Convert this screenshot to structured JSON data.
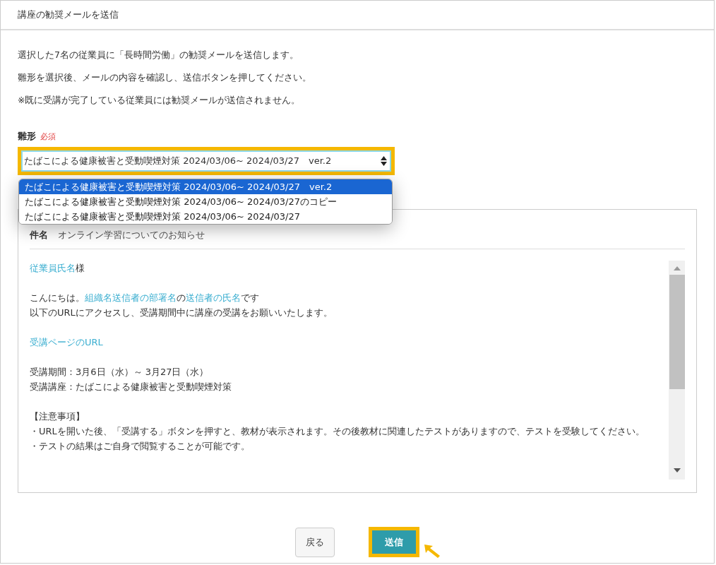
{
  "dialog": {
    "title": "講座の勧奨メールを送信"
  },
  "intro": [
    "選択した7名の従業員に「長時間労働」の勧奨メールを送信します。",
    "雛形を選択後、メールの内容を確認し、送信ボタンを押してください。",
    "※既に受講が完了している従業員には勧奨メールが送信されません。"
  ],
  "template_field": {
    "label": "雛形",
    "required": "必須",
    "value": "たばこによる健康被害と受動喫煙対策 2024/03/06~ 2024/03/27　ver.2",
    "expanded": true,
    "options": [
      {
        "label": "たばこによる健康被害と受動喫煙対策 2024/03/06~ 2024/03/27　ver.2",
        "selected": true
      },
      {
        "label": "たばこによる健康被害と受動喫煙対策 2024/03/06~ 2024/03/27のコピー",
        "selected": false
      },
      {
        "label": "たばこによる健康被害と受動喫煙対策 2024/03/06~ 2024/03/27",
        "selected": false
      }
    ]
  },
  "mail": {
    "subject_label": "件名",
    "subject": "オンライン学習についてのお知らせ",
    "paragraphs": [
      [
        [
          {
            "kind": "field",
            "text": "従業員氏名"
          },
          {
            "kind": "text",
            "text": "様"
          }
        ]
      ],
      [
        [
          {
            "kind": "text",
            "text": "こんにちは。"
          },
          {
            "kind": "field",
            "text": "組織名送信者の部署名"
          },
          {
            "kind": "text",
            "text": "の"
          },
          {
            "kind": "field",
            "text": "送信者の氏名"
          },
          {
            "kind": "text",
            "text": "です"
          }
        ],
        [
          {
            "kind": "text",
            "text": "以下のURLにアクセスし、受講期間中に講座の受講をお願いいたします。"
          }
        ]
      ],
      [
        [
          {
            "kind": "field",
            "text": "受講ページのURL"
          }
        ]
      ],
      [
        [
          {
            "kind": "text",
            "text": "受講期間：3月6日（水）～ 3月27日（水）"
          }
        ],
        [
          {
            "kind": "text",
            "text": "受講講座：たばこによる健康被害と受動喫煙対策"
          }
        ]
      ],
      [
        [
          {
            "kind": "text",
            "text": "【注意事項】"
          }
        ],
        [
          {
            "kind": "text",
            "text": "・URLを開いた後、「受講する」ボタンを押すと、教材が表示されます。その後教材に関連したテストがありますので、テストを受験してください。"
          }
        ],
        [
          {
            "kind": "text",
            "text": "・テストの結果はご自身で閲覧することが可能です。"
          }
        ]
      ]
    ]
  },
  "buttons": [
    {
      "label": "戻る",
      "kind": "secondary"
    },
    {
      "label": "送信",
      "kind": "primary"
    }
  ]
}
